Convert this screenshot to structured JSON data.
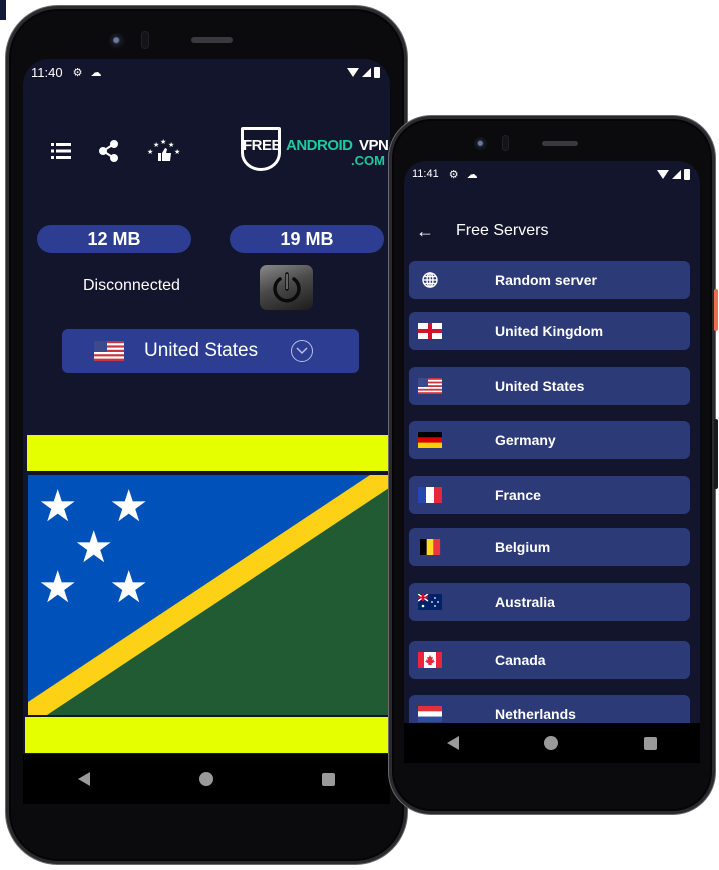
{
  "left_phone": {
    "status_bar": {
      "time": "11:40",
      "icons": [
        "gear-icon",
        "cloud-icon",
        "wifi-icon",
        "signal-icon",
        "battery-icon"
      ]
    },
    "toolbar": {
      "icons": [
        "list-icon",
        "share-icon",
        "rate-stars-icon"
      ]
    },
    "logo": {
      "part1": "FREE",
      "part2": "ANDROID",
      "part3": "VPN",
      "part4": ".COM"
    },
    "stats": {
      "download": "12 MB",
      "upload": "19 MB"
    },
    "connection_status": "Disconnected",
    "selected_country": {
      "name": "United States",
      "flag": "us-flag"
    },
    "banner_flag": "Solomon Islands",
    "colors": {
      "background": "#12152b",
      "accent": "#2c3d92",
      "banner_band": "#e6ff00",
      "logo_green": "#1fc9a0"
    }
  },
  "right_phone": {
    "status_bar": {
      "time": "11:41",
      "icons": [
        "gear-icon",
        "cloud-icon",
        "wifi-icon",
        "signal-icon",
        "battery-icon"
      ]
    },
    "appbar": {
      "back_icon": "arrow-left-icon",
      "title": "Free Servers"
    },
    "servers": [
      {
        "name": "Random server",
        "flag": "globe"
      },
      {
        "name": "United Kingdom",
        "flag": "gb"
      },
      {
        "name": "United States",
        "flag": "us"
      },
      {
        "name": "Germany",
        "flag": "de"
      },
      {
        "name": "France",
        "flag": "fr"
      },
      {
        "name": "Belgium",
        "flag": "be"
      },
      {
        "name": "Australia",
        "flag": "au"
      },
      {
        "name": "Canada",
        "flag": "ca"
      },
      {
        "name": "Netherlands",
        "flag": "nl"
      }
    ],
    "colors": {
      "item_bg": "#2c3a78"
    }
  }
}
